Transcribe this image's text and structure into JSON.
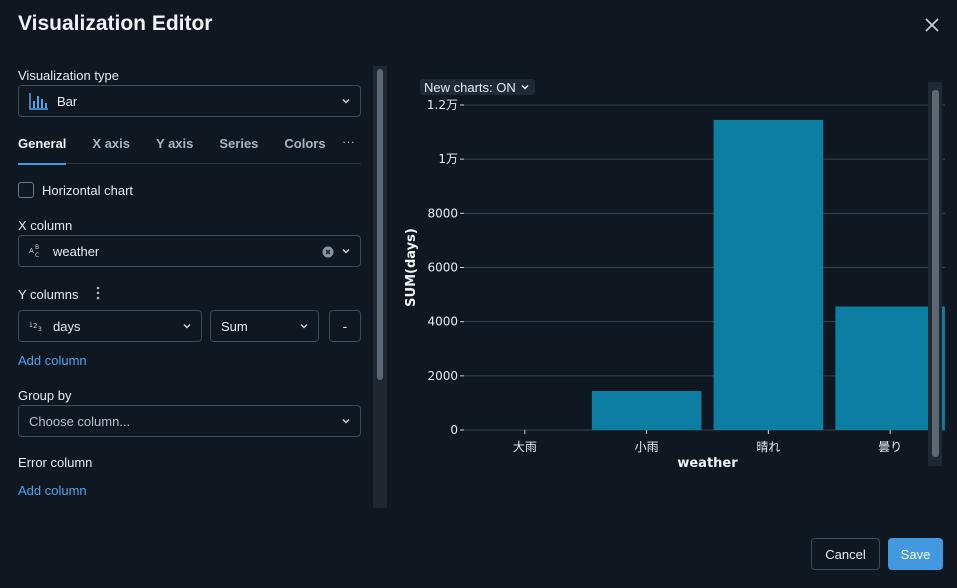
{
  "dialog": {
    "title": "Visualization Editor"
  },
  "viz_type": {
    "label": "Visualization type",
    "value": "Bar"
  },
  "tabs": [
    "General",
    "X axis",
    "Y axis",
    "Series",
    "Colors"
  ],
  "tab_more": "···",
  "horizontal_chart": {
    "label": "Horizontal chart",
    "checked": false
  },
  "x_column": {
    "label": "X column",
    "value": "weather",
    "type_icon": "text-type-icon"
  },
  "y_columns": {
    "label": "Y columns",
    "column": "days",
    "aggregation": "Sum",
    "remove_label": "-",
    "type_icon": "number-type-icon"
  },
  "add_column_label": "Add column",
  "group_by": {
    "label": "Group by",
    "placeholder": "Choose column..."
  },
  "error_column": {
    "label": "Error column"
  },
  "chart_toggle": "New charts: ON",
  "footer": {
    "cancel": "Cancel",
    "save": "Save"
  },
  "colors": {
    "bar": "#0b7ea1",
    "accent": "#4299e0"
  },
  "chart_data": {
    "type": "bar",
    "categories": [
      "大雨",
      "小雨",
      "晴れ",
      "曇り"
    ],
    "values": [
      0,
      1440,
      11450,
      4560
    ],
    "xlabel": "weather",
    "ylabel": "SUM(days)",
    "ylim": [
      0,
      12000
    ],
    "yticks": [
      0,
      2000,
      4000,
      6000,
      8000,
      10000,
      12000
    ],
    "ytick_labels": [
      "0",
      "2000",
      "4000",
      "6000",
      "8000",
      "1万",
      "1.2万"
    ],
    "grid": true,
    "legend": "none"
  }
}
